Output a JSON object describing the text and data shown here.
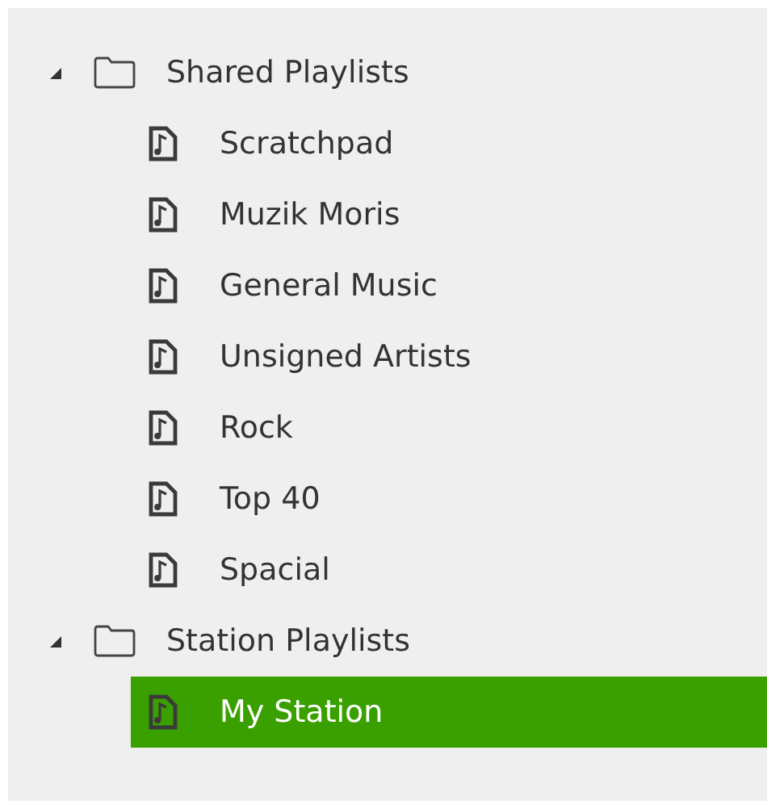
{
  "tree": [
    {
      "label": "Shared Playlists",
      "expanded": true,
      "children": [
        {
          "label": "Scratchpad",
          "selected": false
        },
        {
          "label": "Muzik Moris",
          "selected": false
        },
        {
          "label": "General Music",
          "selected": false
        },
        {
          "label": "Unsigned Artists",
          "selected": false
        },
        {
          "label": "Rock",
          "selected": false
        },
        {
          "label": "Top 40",
          "selected": false
        },
        {
          "label": "Spacial",
          "selected": false
        }
      ]
    },
    {
      "label": "Station Playlists",
      "expanded": true,
      "children": [
        {
          "label": "My Station",
          "selected": true
        }
      ]
    }
  ]
}
